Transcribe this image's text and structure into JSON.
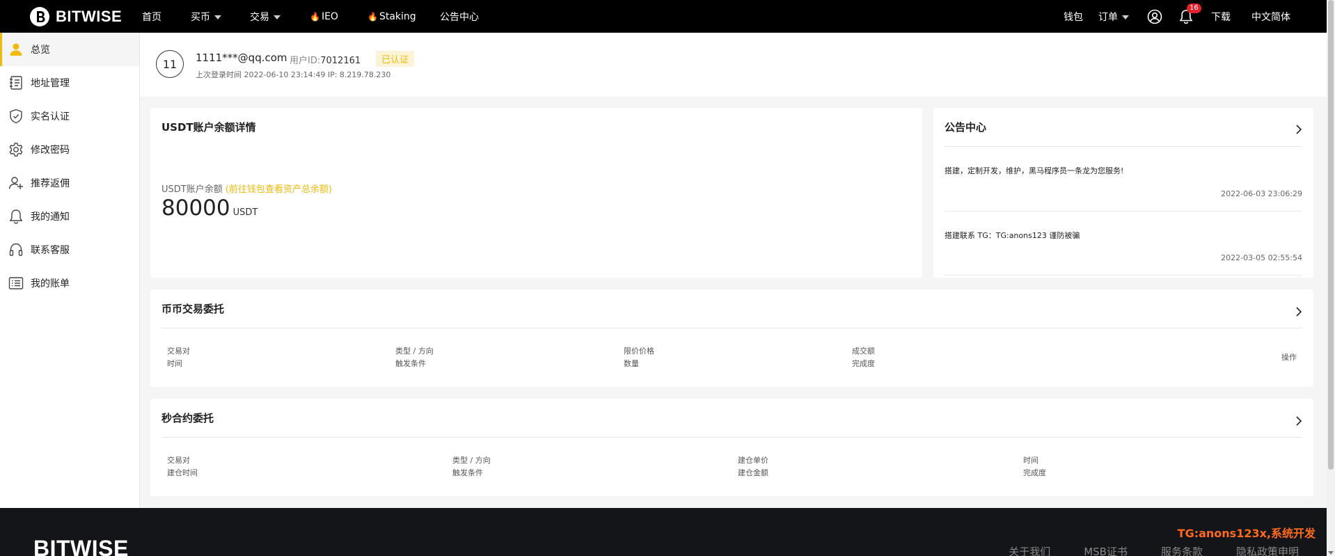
{
  "brand": {
    "name": "BITWISE",
    "accent": "#f0b90b"
  },
  "nav": {
    "items": [
      {
        "label": "首页",
        "dropdown": false,
        "hot": false
      },
      {
        "label": "买币",
        "dropdown": true,
        "hot": false
      },
      {
        "label": "交易",
        "dropdown": true,
        "hot": false
      },
      {
        "label": "IEO",
        "dropdown": false,
        "hot": true
      },
      {
        "label": "Staking",
        "dropdown": false,
        "hot": true
      },
      {
        "label": "公告中心",
        "dropdown": false,
        "hot": false
      }
    ],
    "right": {
      "wallet": "钱包",
      "orders": "订单",
      "notification_count": "16",
      "download": "下载",
      "language": "中文简体"
    }
  },
  "sidebar": {
    "items": [
      {
        "label": "总览",
        "icon": "user-icon",
        "active": true
      },
      {
        "label": "地址管理",
        "icon": "address-book-icon",
        "active": false
      },
      {
        "label": "实名认证",
        "icon": "shield-check-icon",
        "active": false
      },
      {
        "label": "修改密码",
        "icon": "gear-icon",
        "active": false
      },
      {
        "label": "推荐返佣",
        "icon": "add-user-icon",
        "active": false
      },
      {
        "label": "我的通知",
        "icon": "bell-icon",
        "active": false
      },
      {
        "label": "联系客服",
        "icon": "headset-icon",
        "active": false
      },
      {
        "label": "我的账单",
        "icon": "list-icon",
        "active": false
      }
    ]
  },
  "user": {
    "avatar_text": "11",
    "email": "1111***@qq.com",
    "uid_label": "用户ID:",
    "uid": "7012161",
    "verified": "已认证",
    "last_login": "上次登录时间 2022-06-10 23:14:49   IP: 8.219.78.230"
  },
  "balance": {
    "title": "USDT账户余额详情",
    "label": "USDT账户余额",
    "link": "(前往钱包查看资产总余额)",
    "value": "80000",
    "unit": "USDT"
  },
  "announcements": {
    "title": "公告中心",
    "items": [
      {
        "text": "搭建，定制开发，维护，黑马程序员一条龙为您服务!",
        "date": "2022-06-03 23:06:29"
      },
      {
        "text": "搭建联系 TG：TG:anons123 谨防被骗",
        "date": "2022-03-05 02:55:54"
      }
    ]
  },
  "spot_orders": {
    "title": "币币交易委托",
    "columns": [
      {
        "line1": "交易对",
        "line2": "时间"
      },
      {
        "line1": "类型 / 方向",
        "line2": "触发条件"
      },
      {
        "line1": "限价价格",
        "line2": "数量"
      },
      {
        "line1": "成交额",
        "line2": "完成度"
      }
    ],
    "action": "操作"
  },
  "second_contracts": {
    "title": "秒合约委托",
    "columns": [
      {
        "line1": "交易对",
        "line2": "建仓时间"
      },
      {
        "line1": "类型 / 方向",
        "line2": "触发条件"
      },
      {
        "line1": "建仓单价",
        "line2": "建仓金额"
      },
      {
        "line1": "时间",
        "line2": "完成度"
      }
    ]
  },
  "footer": {
    "logo": "BITWISE",
    "tg": "TG:anons123x,系统开发",
    "links": [
      "关于我们",
      "MSB证书",
      "服务条款",
      "隐私政策申明"
    ]
  }
}
